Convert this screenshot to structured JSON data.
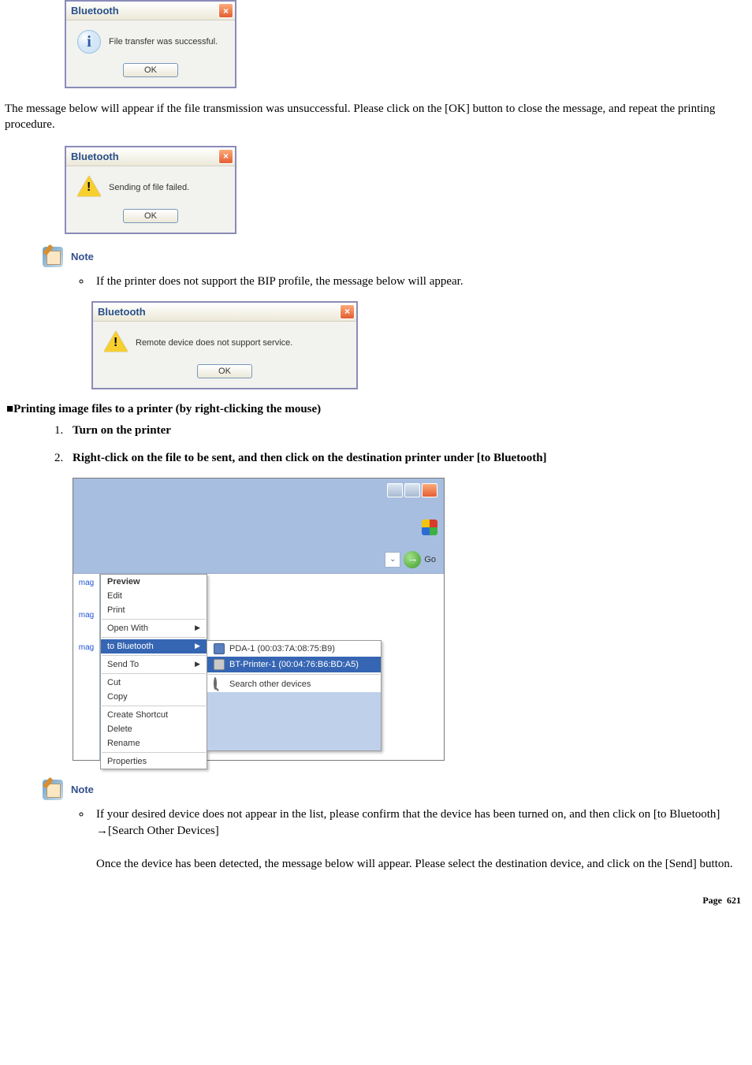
{
  "dialog_success": {
    "title": "Bluetooth",
    "message": "File transfer was successful.",
    "ok": "OK"
  },
  "text1": "The message below will appear if the file transmission was unsuccessful. Please click on the [OK] button to close the message, and repeat the printing procedure.",
  "dialog_failed": {
    "title": "Bluetooth",
    "message": "Sending of file failed.",
    "ok": "OK"
  },
  "note1_label": "Note",
  "note1_bullet": "If the printer does not support the BIP profile, the message below will appear.",
  "dialog_unsupported": {
    "title": "Bluetooth",
    "message": "Remote device does not support service.",
    "ok": "OK"
  },
  "section_heading": "Printing image files to a printer (by right-clicking the mouse)",
  "step1": "Turn on the printer",
  "step2": "Right-click on the file to be sent, and then click on the destination printer under [to Bluetooth]",
  "explorer": {
    "go_label": "Go",
    "side_labels": [
      "mag",
      "mag",
      "mag"
    ],
    "ctx": {
      "preview": "Preview",
      "edit": "Edit",
      "print": "Print",
      "open_with": "Open With",
      "to_bluetooth": "to Bluetooth",
      "send_to": "Send To",
      "cut": "Cut",
      "copy": "Copy",
      "create_shortcut": "Create Shortcut",
      "delete": "Delete",
      "rename": "Rename",
      "properties": "Properties"
    },
    "submenu": {
      "pda": "PDA-1 (00:03:7A:08:75:B9)",
      "printer": "BT-Printer-1 (00:04:76:B6:BD:A5)",
      "search": "Search other devices"
    }
  },
  "note2_label": "Note",
  "note2_bullet_a": "If your desired device does not appear in the list, please confirm that the device has been turned on, and then click on [to Bluetooth] →[Search Other Devices]",
  "note2_bullet_b": "Once the device has been detected, the message below will appear. Please select the destination device, and click on the [Send] button.",
  "page_label": "Page",
  "page_number": "621"
}
